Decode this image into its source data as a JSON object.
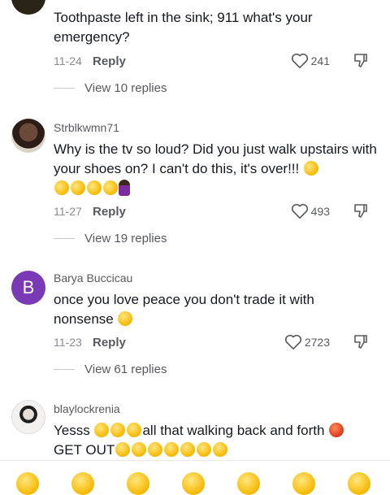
{
  "comments": [
    {
      "username": "",
      "text": "Toothpaste left in the sink; 911 what's your emergency?",
      "date": "11-24",
      "reply_label": "Reply",
      "likes": "241",
      "view_replies": "View 10 replies"
    },
    {
      "username": "Strblkwmn71",
      "text": "Why is the tv so loud? Did you just walk upstairs with your shoes on? I can't do this, it's over!!!",
      "date": "11-27",
      "reply_label": "Reply",
      "likes": "493",
      "view_replies": "View 19 replies"
    },
    {
      "username": "Barya Buccicau",
      "avatar_letter": "B",
      "text": "once you love peace you don't trade it with nonsense",
      "date": "11-23",
      "reply_label": "Reply",
      "likes": "2723",
      "view_replies": "View 61 replies"
    },
    {
      "username": "blaylockrenia",
      "text_part1": "Yesss",
      "text_part2": "all that walking back and forth",
      "text_part3": "GET OUT"
    }
  ],
  "icons": {
    "like": "heart-outline-icon",
    "dislike": "thumbs-down-icon"
  },
  "colors": {
    "text": "#161823",
    "secondary": "#595a61",
    "avatar_b": "#7a3ab5"
  }
}
